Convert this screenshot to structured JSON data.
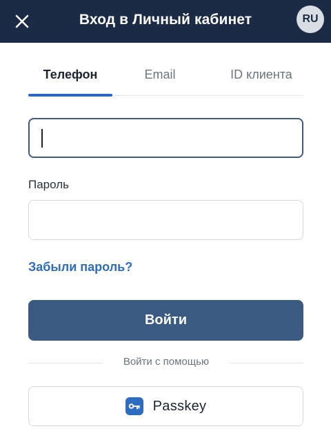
{
  "header": {
    "title": "Вход в Личный кабинет",
    "close_icon": "close-icon",
    "language": "RU",
    "background_color": "#1b2b45"
  },
  "tabs": [
    {
      "label": "Телефон",
      "active": true
    },
    {
      "label": "Email",
      "active": false
    },
    {
      "label": "ID клиента",
      "active": false
    }
  ],
  "form": {
    "phone": {
      "value": "",
      "placeholder": ""
    },
    "password": {
      "label": "Пароль",
      "value": "",
      "placeholder": ""
    },
    "forgot_label": "Забыли пароль?",
    "submit_label": "Войти",
    "alt_login_label": "Войти с помощью",
    "passkey_label": "Passkey",
    "passkey_icon": "key-icon"
  },
  "colors": {
    "accent": "#2d6cc0",
    "button": "#3a5a82",
    "header": "#1b2b45"
  }
}
